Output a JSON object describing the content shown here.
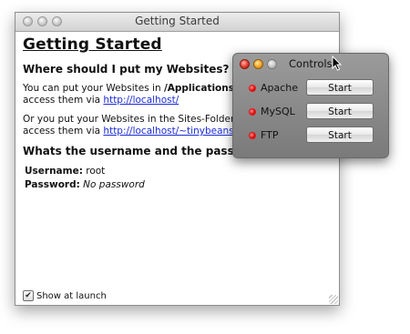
{
  "window": {
    "title": "Getting Started"
  },
  "content": {
    "heading": "Getting Started",
    "websites_heading": "Where should I put my Websites?",
    "para1_line1_pre": "You can put your Websites in ",
    "para1_path": "/Applications/XA",
    "para1_line2_pre": "access them via ",
    "para1_link": "http://localhost/",
    "para2_line1": "Or you put your Websites in the Sites-Folder in",
    "para2_line2_pre": "access them via ",
    "para2_link": "http://localhost/~tinybeans/",
    "para2_line2_post": ".",
    "credentials_heading": "Whats the username and the passwor",
    "username_label": "Username:",
    "username_value": "root",
    "password_label": "Password:",
    "password_value": "No password",
    "show_at_launch_label": "Show at launch",
    "show_at_launch_checked": "✔"
  },
  "controls": {
    "title": "Controls",
    "services": [
      {
        "name": "Apache",
        "status_color": "#e11818",
        "button": "Start"
      },
      {
        "name": "MySQL",
        "status_color": "#e11818",
        "button": "Start"
      },
      {
        "name": "FTP",
        "status_color": "#e11818",
        "button": "Start"
      }
    ]
  }
}
